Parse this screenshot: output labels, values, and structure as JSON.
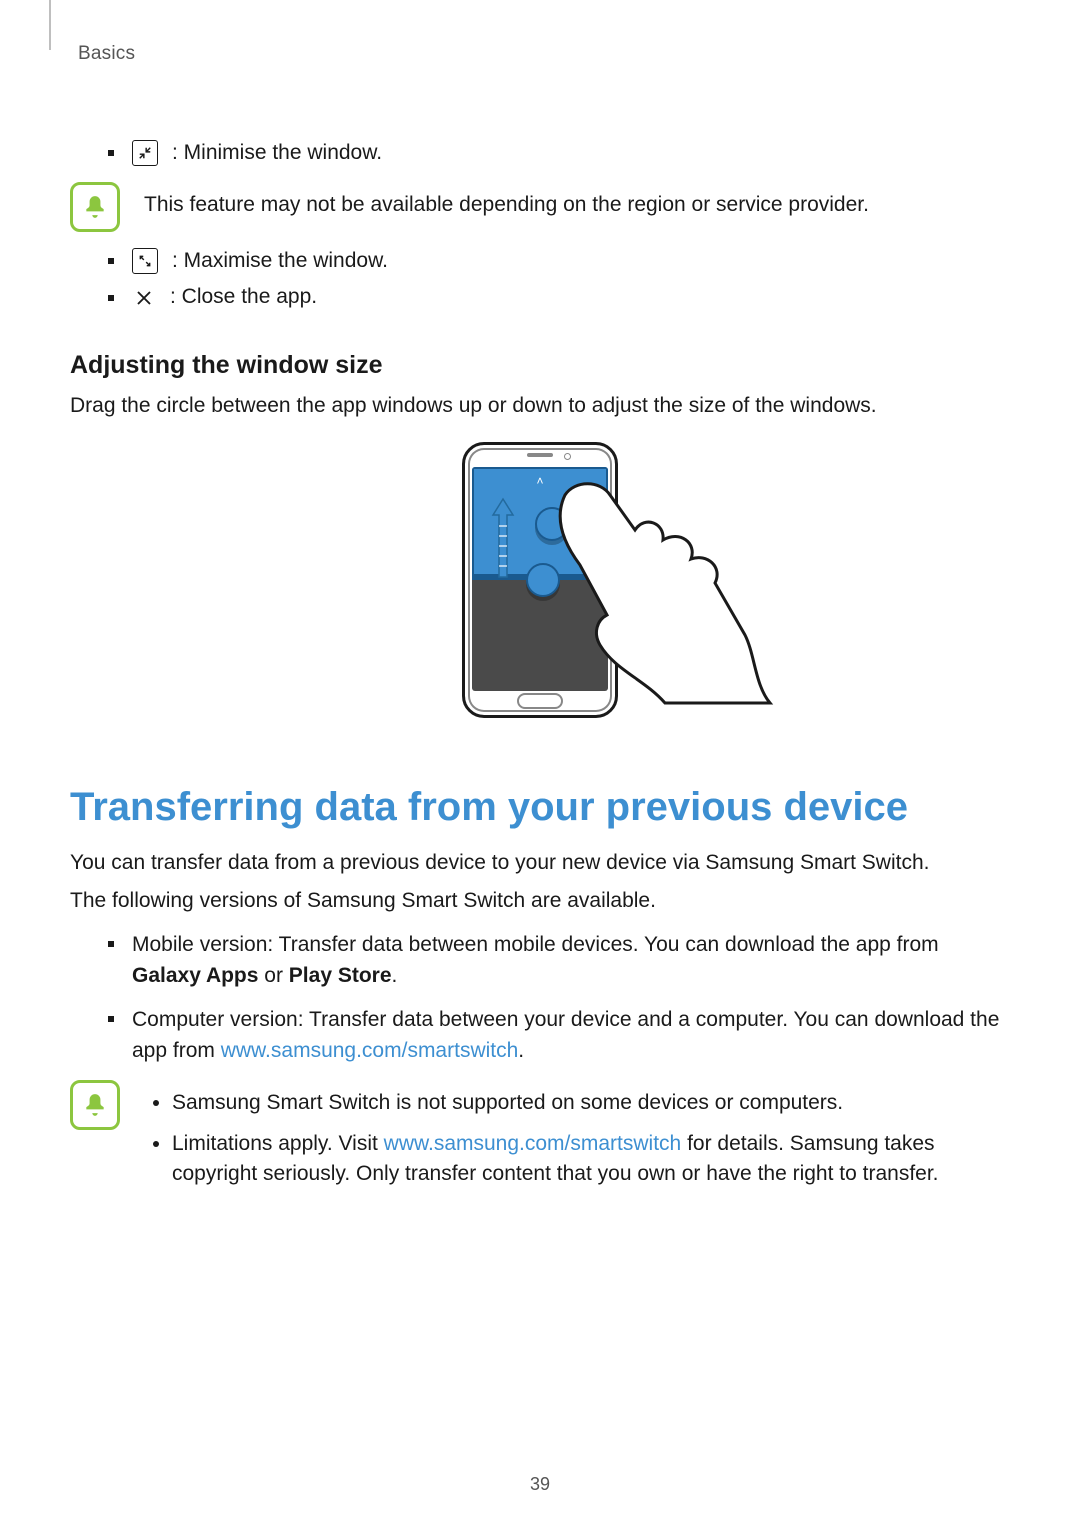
{
  "header": {
    "section": "Basics"
  },
  "actions": {
    "minimise": ": Minimise the window.",
    "maximise": ": Maximise the window.",
    "close": ": Close the app."
  },
  "note1": {
    "text": "This feature may not be available depending on the region or service provider."
  },
  "adjust": {
    "heading": "Adjusting the window size",
    "text": "Drag the circle between the app windows up or down to adjust the size of the windows."
  },
  "transfer": {
    "heading": "Transferring data from your previous device",
    "p1": "You can transfer data from a previous device to your new device via Samsung Smart Switch.",
    "p2": "The following versions of Samsung Smart Switch are available.",
    "bullets": {
      "mobile_pre": "Mobile version: Transfer data between mobile devices. You can download the app from ",
      "galaxy_apps": "Galaxy Apps",
      "or": " or ",
      "play_store": "Play Store",
      "period": ".",
      "computer_pre": "Computer version: Transfer data between your device and a computer. You can download the app from ",
      "computer_link": "www.samsung.com/smartswitch",
      "computer_post": "."
    }
  },
  "note2": {
    "item1": "Samsung Smart Switch is not supported on some devices or computers.",
    "item2_pre": "Limitations apply. Visit ",
    "item2_link": "www.samsung.com/smartswitch",
    "item2_post": " for details. Samsung takes copyright seriously. Only transfer content that you own or have the right to transfer."
  },
  "page_number": "39"
}
